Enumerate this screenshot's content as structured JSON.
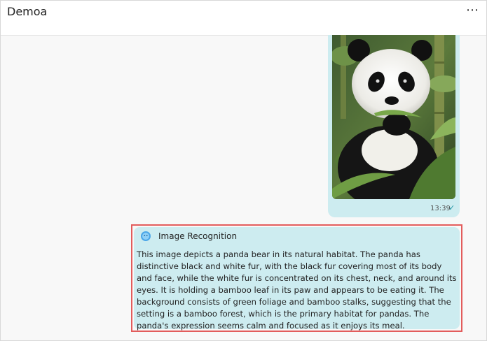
{
  "header": {
    "title": "Demoa",
    "more_icon": "⋯"
  },
  "image_message": {
    "time": "13:39",
    "status_icon": "✓",
    "photo_icon": "panda-photo-icon"
  },
  "bot_message": {
    "sender": "Image Recognition",
    "avatar_icon": "bot-avatar-icon",
    "text": "This image depicts a panda bear in its natural habitat. The panda has distinctive black and white fur, with the black fur covering most of its body and face, while the white fur is concentrated on its chest, neck, and around its eyes. It is holding a bamboo leaf in its paw and appears to be eating it. The background consists of green foliage and bamboo stalks, suggesting that the setting is a bamboo forest, which is the primary habitat for pandas. The panda's expression seems calm and focused as it enjoys its meal."
  },
  "colors": {
    "bubble": "#cdecf0",
    "highlight": "#e35c5c",
    "check": "#2a9aa8"
  }
}
